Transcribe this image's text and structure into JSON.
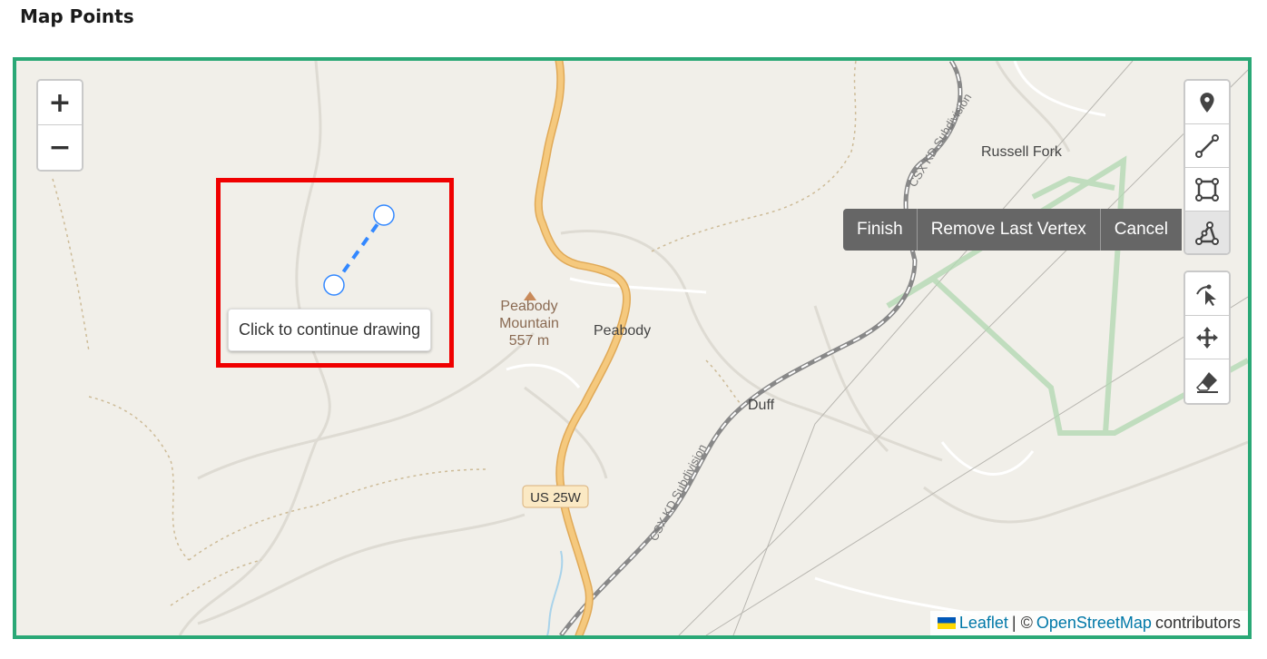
{
  "page": {
    "title": "Map Points"
  },
  "zoom": {
    "in_label": "+",
    "out_label": "−"
  },
  "draw_toolbar": {
    "tools": [
      "marker-icon",
      "polyline-icon",
      "rectangle-icon",
      "polygon-icon"
    ],
    "active": "polygon-icon"
  },
  "edit_toolbar": {
    "tools": [
      "edit-vertex-icon",
      "move-icon",
      "eraser-icon"
    ]
  },
  "draw_actions": {
    "finish": "Finish",
    "remove_last": "Remove Last Vertex",
    "cancel": "Cancel"
  },
  "tooltip": {
    "text": "Click to continue drawing"
  },
  "map_labels": {
    "peak_name_1": "Peabody",
    "peak_name_2": "Mountain",
    "peak_elevation": "557 m",
    "place_peabody": "Peabody",
    "place_duff": "Duff",
    "place_russell_fork": "Russell Fork",
    "road_shield": "US 25W",
    "rail_1": "CSX KD Subdivision",
    "rail_2": "CSX KD Subdivision"
  },
  "attribution": {
    "leaflet": "Leaflet",
    "separator": "| ©",
    "osm": "OpenStreetMap",
    "suffix": "contributors"
  },
  "colors": {
    "frame_border": "#2aa876",
    "highlight": "#f00000",
    "draw_line": "#3388ff",
    "road": "#f5c97e",
    "map_bg": "#f1efe9",
    "boundary": "#b4d9b4"
  }
}
